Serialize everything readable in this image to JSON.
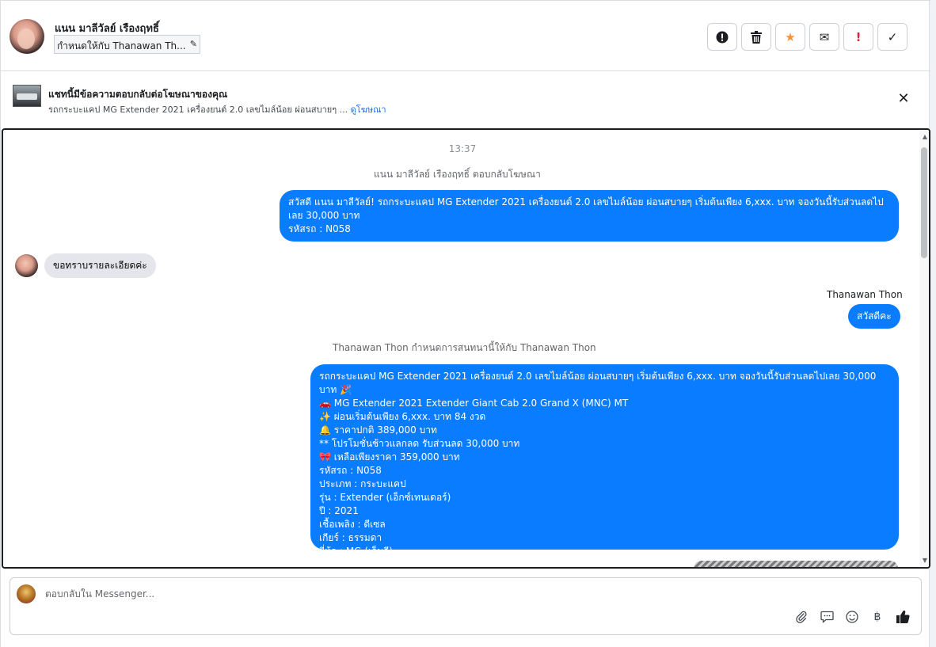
{
  "header": {
    "contact_name": "แนน มาลีวัลย์ เรืองฤทธิ์",
    "assigned_to": "กำหนดให้กับ Thanawan Th...",
    "actions": [
      {
        "name": "report-icon",
        "glyph": "!"
      },
      {
        "name": "trash-icon",
        "glyph": "🗑"
      },
      {
        "name": "star-icon",
        "glyph": "★"
      },
      {
        "name": "envelope-icon",
        "glyph": "✉"
      },
      {
        "name": "alert-icon",
        "glyph": "!"
      },
      {
        "name": "check-icon",
        "glyph": "✓"
      }
    ]
  },
  "banner": {
    "title": "แชทนี้มีข้อความตอบกลับต่อโฆษณาของคุณ",
    "subtitle": "รถกระบะแคป MG Extender 2021 เครื่องยนต์ 2.0 เลขไมล์น้อย ผ่อนสบายๆ ...",
    "link": "ดูโฆษณา",
    "close": "✕"
  },
  "chat": {
    "time": "13:37",
    "system_1": "แนน มาลีวัลย์ เรืองฤทธิ์ ตอบกลับโฆษณา",
    "msg_out_1": "สวัสดี แนน มาลีวัลย์! รถกระบะแคป MG Extender 2021 เครื่องยนต์ 2.0 เลขไมล์น้อย ผ่อนสบายๆ เริ่มต้นเพียง 6,xxx. บาท จองวันนี้รับส่วนลดไปเลย 30,000 บาท\n รหัสรถ : N058",
    "msg_in_1": "ขอทราบรายละเอียดค่ะ",
    "sender_1": "Thanawan Thon",
    "msg_out_2": "สวัสดีคะ",
    "system_2": "Thanawan Thon กำหนดการสนทนานี้ให้กับ Thanawan Thon",
    "msg_out_3": "รถกระบะแคป MG Extender 2021 เครื่องยนต์ 2.0 เลขไมล์น้อย ผ่อนสบายๆ เริ่มต้นเพียง 6,xxx. บาท จองวันนี้รับส่วนลดไปเลย 30,000 บาท 🎉\n🚗   MG Extender 2021 Extender Giant Cab 2.0 Grand X (MNC) MT\n✨   ผ่อนเริ่มต้นเพียง 6,xxx. บาท 84 งวด\n🔔    ราคาปกติ 389,000 บาท\n** โปรโมชั่นช้าวแลกลด รับส่วนลด 30,000 บาท\n🎀   เหลือเพียงราคา 359,000 บาท\n   รหัสรถ : N058\n   ประเภท : กระบะแคป\n   รุ่น : Extender (เอ็กซ์เทนเดอร์)\n   ปี : 2021\n   เชื้อเพลิง : ดีเซล\n   เกียร์ : ธรรมดา\n   ยี่ห้อ : MG (เอ็มจี)"
  },
  "composer": {
    "placeholder": "ตอบกลับใน Messenger...",
    "tools": [
      "paperclip-icon",
      "speech-bubble-icon",
      "smiley-icon",
      "baht-icon",
      "thumbs-up-icon"
    ]
  }
}
